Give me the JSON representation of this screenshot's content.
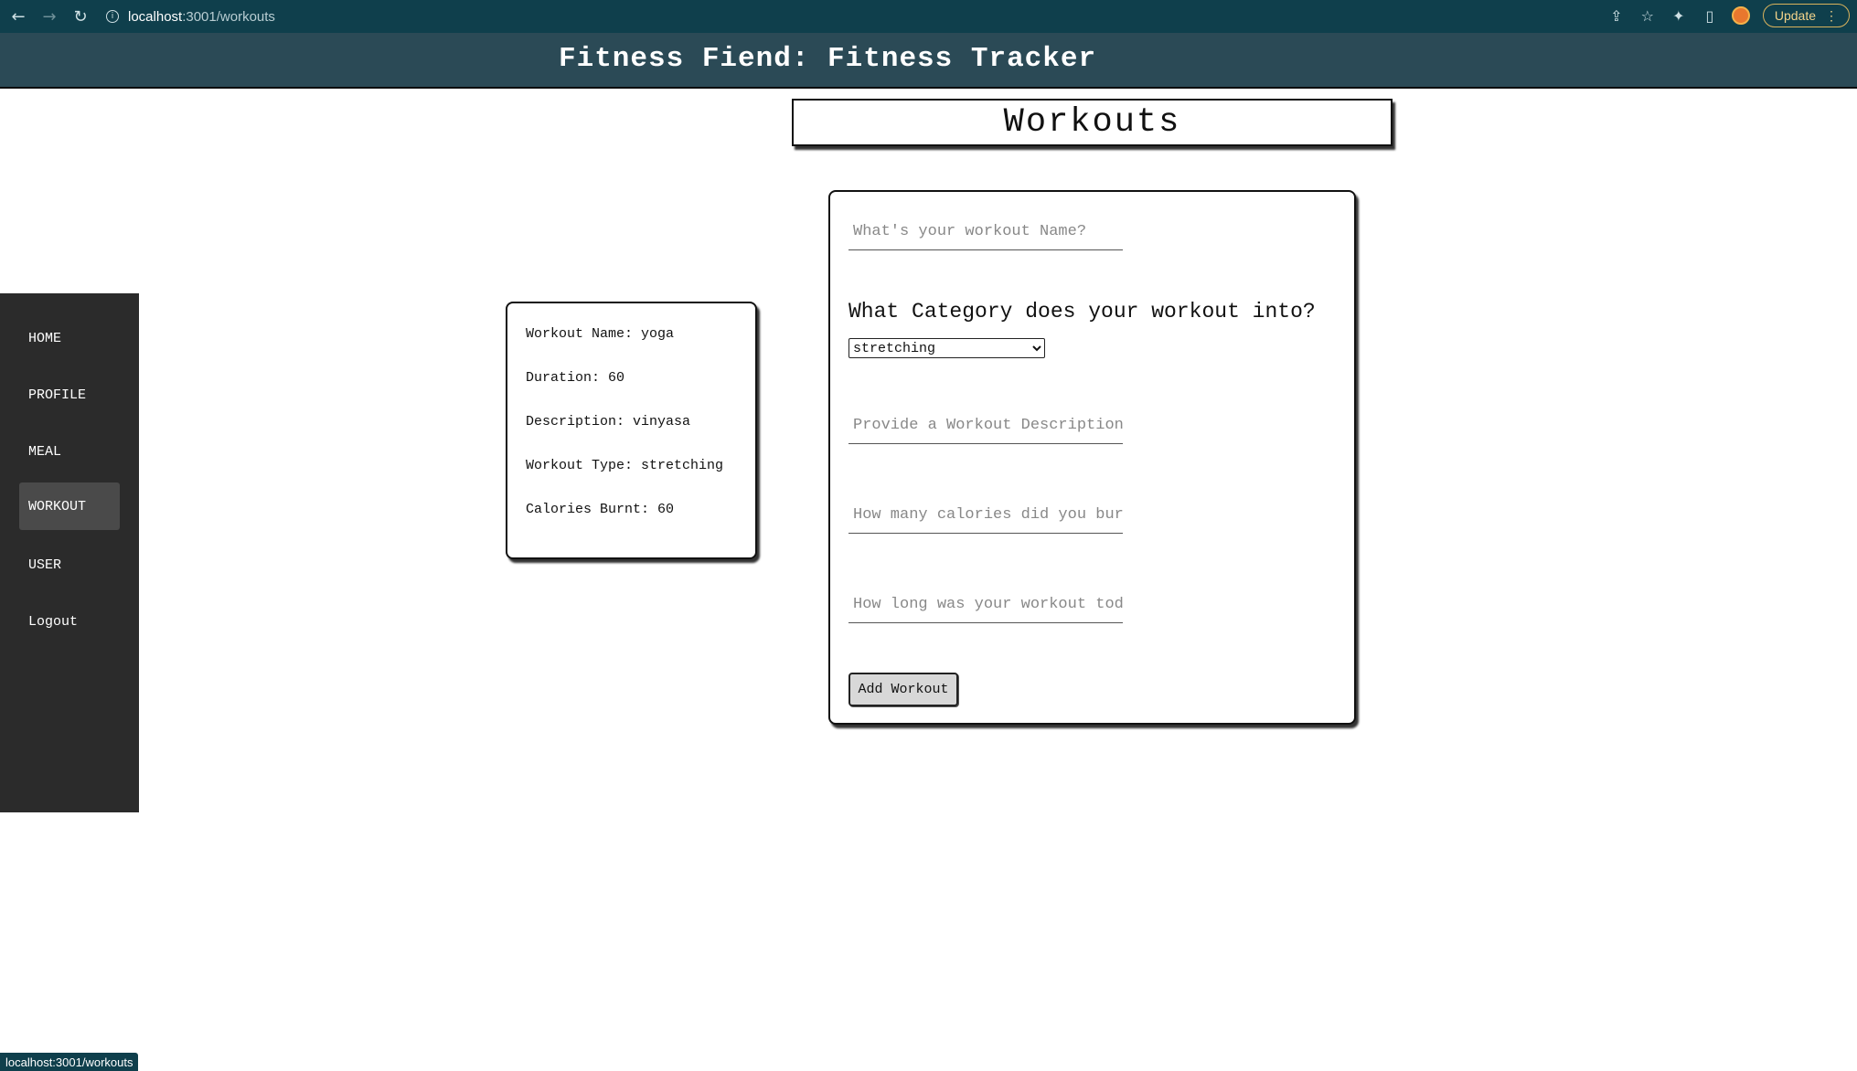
{
  "browser": {
    "url_host": "localhost",
    "url_path": ":3001/workouts",
    "update_label": "Update"
  },
  "header": {
    "title": "Fitness Fiend: Fitness Tracker"
  },
  "page": {
    "title": "Workouts"
  },
  "sidebar": {
    "items": [
      {
        "label": "HOME"
      },
      {
        "label": "PROFILE"
      },
      {
        "label": "MEAL"
      },
      {
        "label": "WORKOUT"
      },
      {
        "label": "USER"
      },
      {
        "label": "Logout"
      }
    ]
  },
  "workout_card": {
    "name": "Workout Name: yoga",
    "duration": "Duration: 60",
    "description": "Description: vinyasa",
    "type": "Workout Type: stretching",
    "calories": "Calories Burnt: 60"
  },
  "form": {
    "name_placeholder": "What's your workout Name?",
    "category_label": "What Category does your workout into?",
    "category_selected": "stretching",
    "description_placeholder": "Provide a Workout Description!",
    "calories_placeholder": "How many calories did you burn today!?",
    "duration_placeholder": "How long was your workout today?",
    "submit_label": "Add Workout"
  },
  "status_bar": {
    "text": "localhost:3001/workouts"
  }
}
